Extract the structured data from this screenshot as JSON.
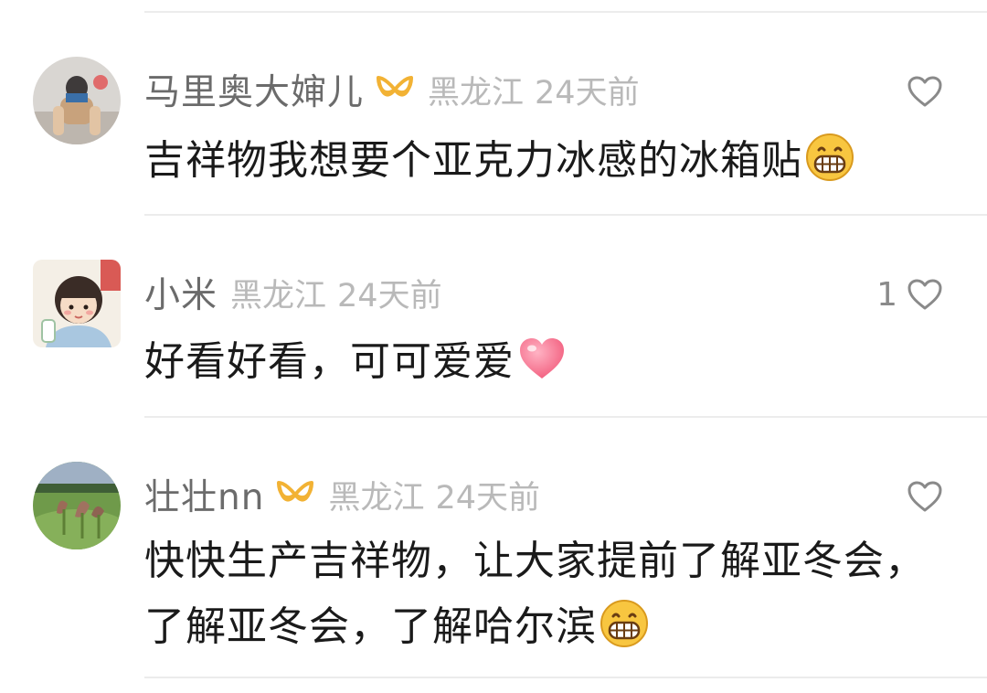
{
  "comments": [
    {
      "username": "马里奥大婶儿",
      "has_badge": true,
      "location": "黑龙江",
      "time": "24天前",
      "likes": "",
      "text": "吉祥物我想要个亚克力冰感的冰箱贴",
      "emoji": "grin-emoji"
    },
    {
      "username": "小米",
      "has_badge": false,
      "location": "黑龙江",
      "time": "24天前",
      "likes": "1",
      "text": "好看好看，可可爱爱",
      "emoji": "heart-emoji"
    },
    {
      "username": "壮壮nn",
      "has_badge": true,
      "location": "黑龙江",
      "time": "24天前",
      "likes": "",
      "text": "快快生产吉祥物，让大家提前了解亚冬会，了解亚冬会，了解哈尔滨",
      "emoji": "grin-emoji"
    }
  ],
  "colors": {
    "username": "#6b6b6b",
    "meta": "#b9b9b9",
    "text": "#1a1a1a",
    "badge": "#f2b234",
    "divider": "#ececec"
  }
}
